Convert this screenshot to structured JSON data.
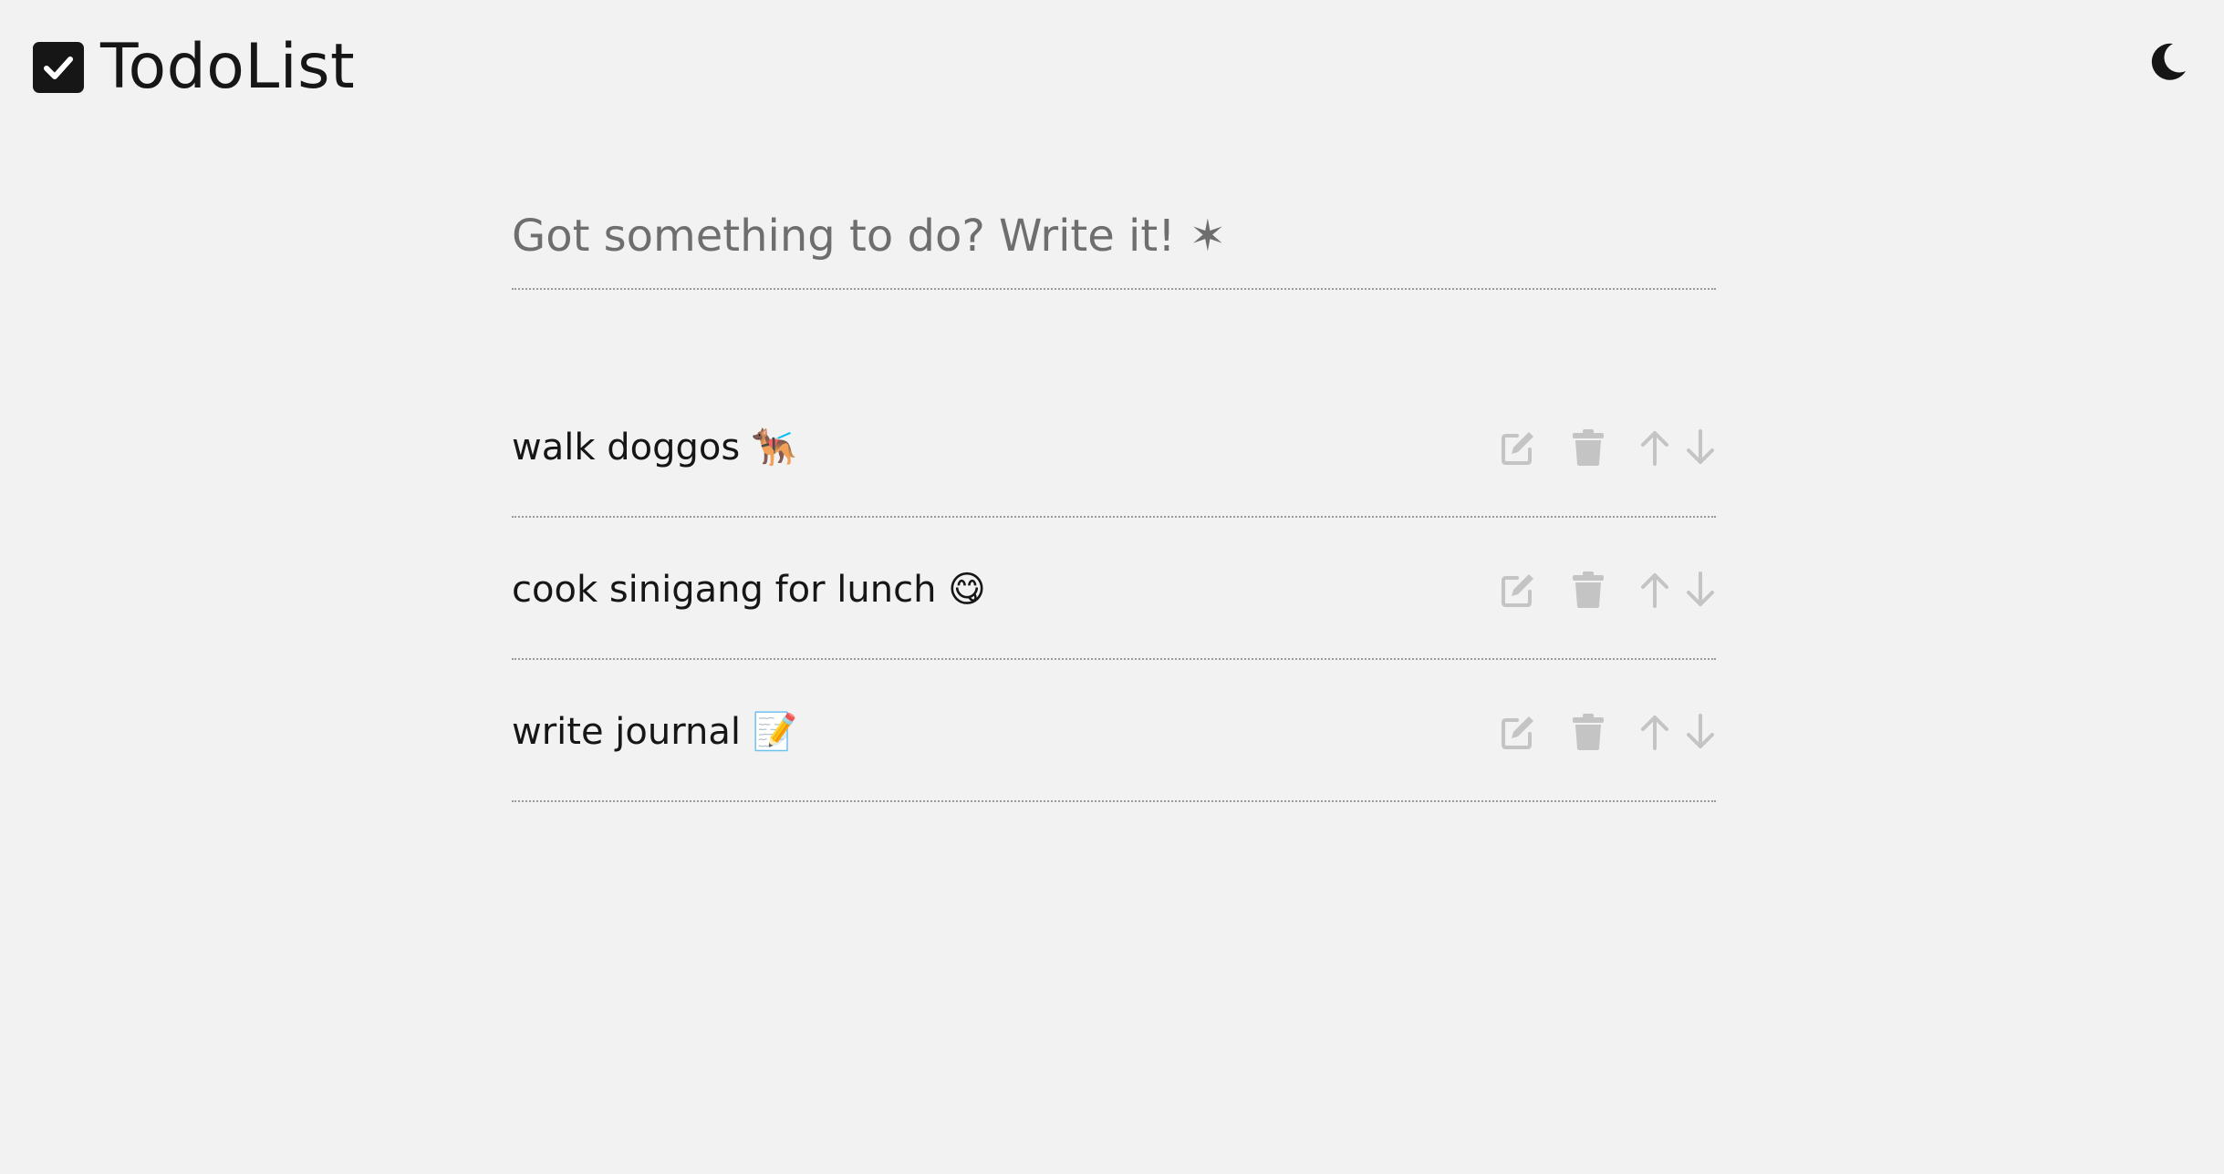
{
  "app": {
    "title": "TodoList",
    "logo_icon": "checkbox-checked-icon",
    "theme_toggle_icon": "moon-icon"
  },
  "input": {
    "placeholder": "Got something to do? Write it! ✶",
    "value": ""
  },
  "todos": [
    {
      "text": "walk doggos 🐕‍🦺"
    },
    {
      "text": "cook sinigang for lunch 😋"
    },
    {
      "text": "write journal 📝"
    }
  ],
  "icons": {
    "edit": "edit-icon",
    "delete": "trash-icon",
    "move_up": "arrow-up-icon",
    "move_down": "arrow-down-icon"
  },
  "colors": {
    "background": "#f2f2f2",
    "text": "#161616",
    "placeholder": "#6e6e6e",
    "icon_muted": "#c4c4c4",
    "divider": "#9a9a9a"
  }
}
